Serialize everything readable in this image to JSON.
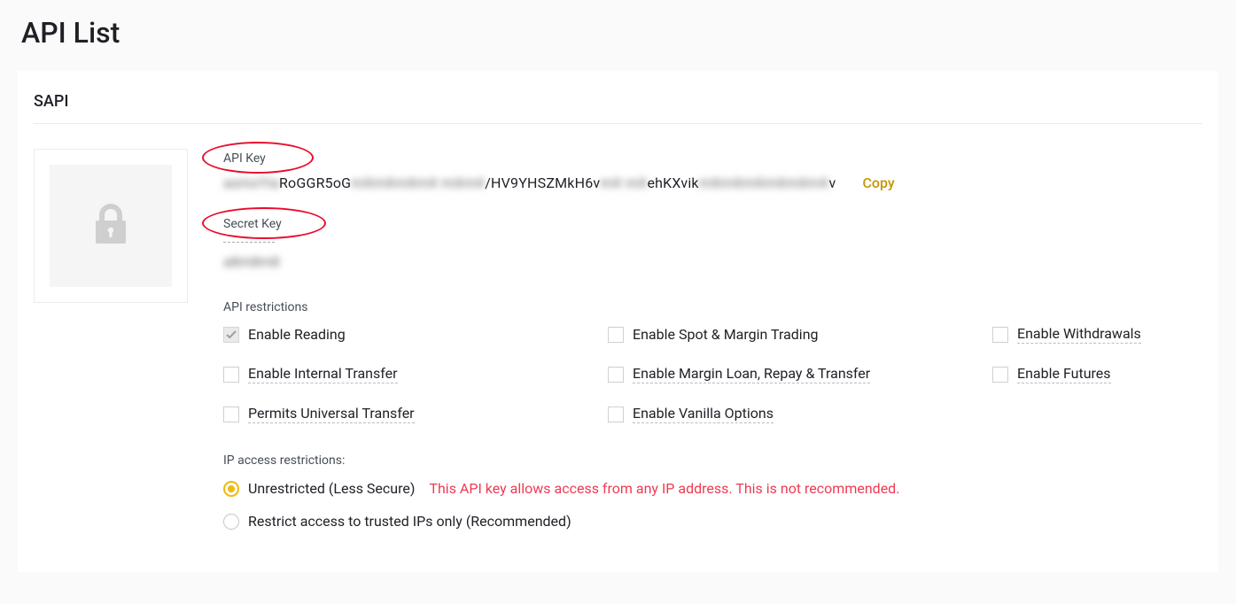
{
  "page": {
    "title": "API List"
  },
  "card": {
    "header": "SAPI",
    "apiKey": {
      "label": "API Key",
      "segments": [
        {
          "blur": true,
          "text": "asmxYIa"
        },
        {
          "blur": false,
          "text": "RoGGR5oG"
        },
        {
          "blur": true,
          "text": "mXmXmXmX mXmX"
        },
        {
          "blur": false,
          "text": "/HV9YHSZMkH6v"
        },
        {
          "blur": true,
          "text": "mX mX"
        },
        {
          "blur": false,
          "text": "ehKXvik"
        },
        {
          "blur": true,
          "text": "mXmXmXmXmXmX"
        },
        {
          "blur": false,
          "text": "v"
        }
      ],
      "copy": "Copy"
    },
    "secretKey": {
      "label": "Secret Key",
      "valueBlur": "a8m8m8"
    },
    "restrictions": {
      "title": "API restrictions",
      "items": [
        {
          "id": "reading",
          "label": "Enable Reading",
          "checked": true,
          "underline": false
        },
        {
          "id": "spotmargin",
          "label": "Enable Spot & Margin Trading",
          "checked": false,
          "underline": false
        },
        {
          "id": "withdrawals",
          "label": "Enable Withdrawals",
          "checked": false,
          "underline": true
        },
        {
          "id": "internaltransfer",
          "label": "Enable Internal Transfer",
          "checked": false,
          "underline": true
        },
        {
          "id": "marginloan",
          "label": "Enable Margin Loan, Repay & Transfer",
          "checked": false,
          "underline": true
        },
        {
          "id": "futures",
          "label": "Enable Futures",
          "checked": false,
          "underline": true
        },
        {
          "id": "universal",
          "label": "Permits Universal Transfer",
          "checked": false,
          "underline": true
        },
        {
          "id": "vanilla",
          "label": "Enable Vanilla Options",
          "checked": false,
          "underline": true
        }
      ]
    },
    "ipAccess": {
      "title": "IP access restrictions:",
      "options": [
        {
          "id": "unrestricted",
          "label": "Unrestricted (Less Secure)",
          "selected": true,
          "warning": "This API key allows access from any IP address. This is not recommended."
        },
        {
          "id": "restricted",
          "label": "Restrict access to trusted IPs only (Recommended)",
          "selected": false
        }
      ]
    }
  }
}
